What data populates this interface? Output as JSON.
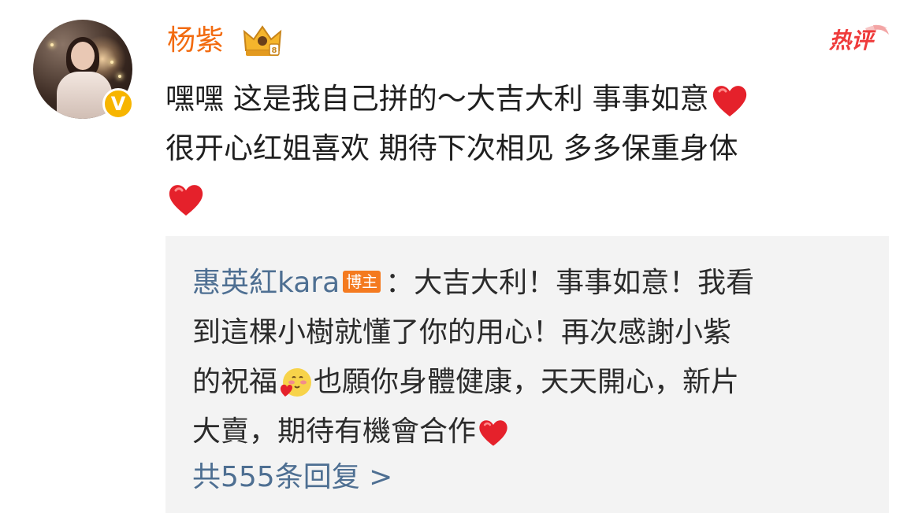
{
  "comment": {
    "author": "杨紫",
    "hot_label": "热评",
    "line1": "嘿嘿 这是我自己拼的～大吉大利 事事如意",
    "line2": "很开心红姐喜欢 期待下次相见 多多保重身体"
  },
  "reply": {
    "author": "惠英紅kara",
    "author_tag": "博主",
    "line1_rest": "：大吉大利！事事如意！我看",
    "line2": "到這棵小樹就懂了你的用心！再次感謝小紫",
    "line3a": "的祝福",
    "line3b": "也願你身體健康，天天開心，新片",
    "line4": "大賣，期待有機會合作",
    "more_replies": "共555条回复 >"
  },
  "icons": {
    "crown": "vip-crown-icon",
    "heart": "red-heart-icon",
    "emoji": "blush-hug-emoji-icon",
    "verified": "verified-v-badge-icon"
  },
  "colors": {
    "username": "#f26b10",
    "reply_user": "#4e6f92",
    "hot_badge": "#ef3b3b",
    "blogger_tag": "#f47a1f",
    "reply_bg": "#f3f3f3"
  }
}
